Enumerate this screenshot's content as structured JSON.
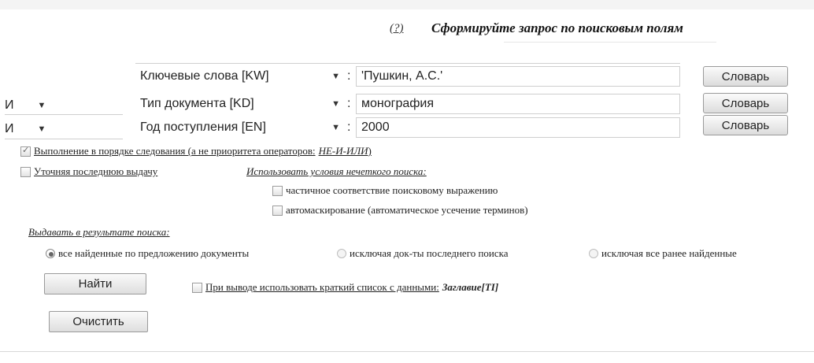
{
  "header": {
    "help_link": "(?)",
    "title": "Сформируйте запрос по поисковым полям"
  },
  "rows": [
    {
      "operator": "",
      "field": "Ключевые слова [KW]",
      "colon": ":",
      "value": "'Пушкин, А.С.'",
      "dict_label": "Словарь"
    },
    {
      "operator": "И",
      "field": "Тип документа [KD]",
      "colon": ":",
      "value": "монография",
      "dict_label": "Словарь"
    },
    {
      "operator": "И",
      "field": "Год поступления [EN]",
      "colon": ":",
      "value": "2000",
      "dict_label": "Словарь"
    }
  ],
  "options": {
    "order_label": "Выполнение в порядке следования (а не приоритета операторов:",
    "order_ops": "НЕ-И-ИЛИ",
    "order_close": ")",
    "refine_label": "Уточняя последнюю выдачу",
    "fuzzy_heading": "Использовать условия нечеткого поиска:",
    "partial_label": "частичное соответствие поисковому выражению",
    "automask_label": "автомаскирование (автоматическое усечение терминов)"
  },
  "results": {
    "heading": "Выдавать в результате поиска:",
    "radio_all": "все найденные по предложению документы",
    "radio_excl_last": "исключая док-ты последнего поиска",
    "radio_excl_all": "исключая все ранее найденные"
  },
  "actions": {
    "find_label": "Найти",
    "clear_label": "Очистить",
    "brief_list_label": "При выводе использовать краткий список с данными:",
    "brief_list_value": "Заглавие[TI]"
  }
}
